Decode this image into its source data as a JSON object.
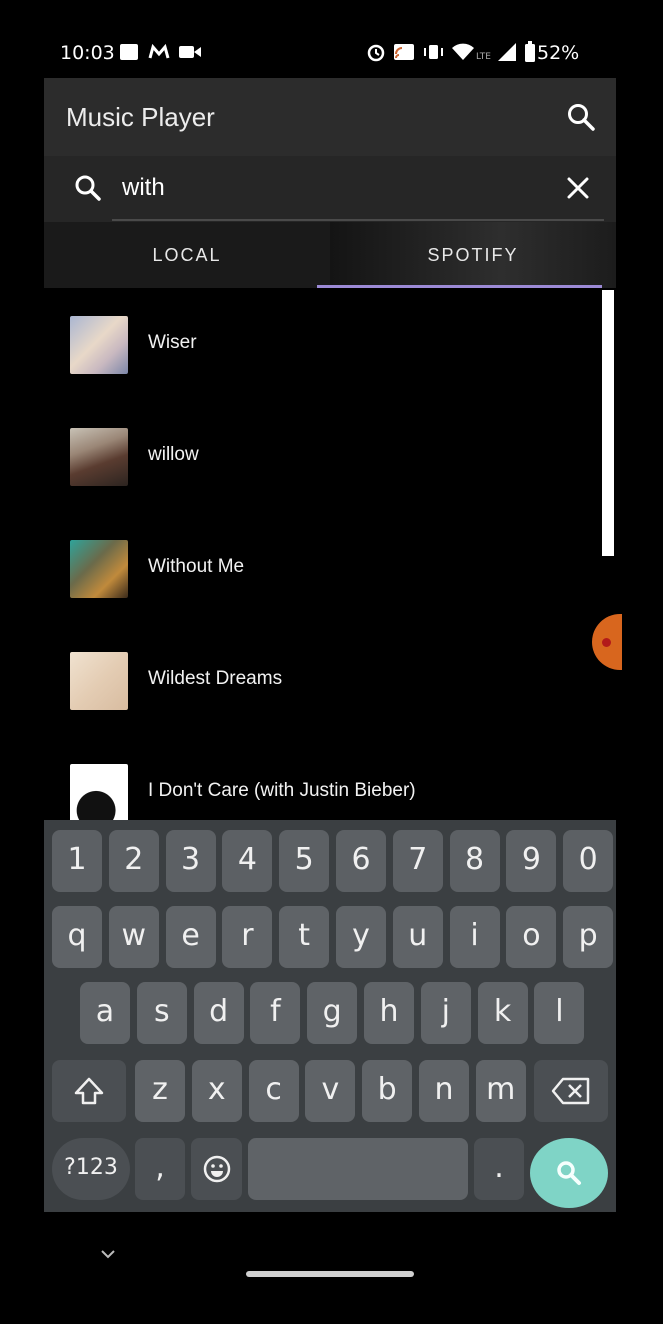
{
  "status_bar": {
    "time": "10:03",
    "battery": "52%",
    "icons": [
      "linkedin-icon",
      "gmail-icon",
      "video-icon",
      "alarm-icon",
      "cast-icon",
      "vibrate-icon",
      "wifi-icon",
      "lte-icon",
      "signal-icon",
      "battery-icon"
    ]
  },
  "app_bar": {
    "title": "Music Player",
    "search_icon": "search-icon"
  },
  "search": {
    "value": "with",
    "search_icon": "search-icon",
    "clear_icon": "close-icon"
  },
  "tabs": [
    {
      "label": "LOCAL",
      "selected": false
    },
    {
      "label": "SPOTIFY",
      "selected": true
    }
  ],
  "colors": {
    "tab_indicator": "#9c8ad6",
    "accent_search_key": "#7fd4c6",
    "fab": "#d8661e"
  },
  "songs": [
    {
      "title": "Wiser"
    },
    {
      "title": "willow"
    },
    {
      "title": "Without Me"
    },
    {
      "title": "Wildest Dreams"
    },
    {
      "title": "I Don't Care (with Justin Bieber)"
    }
  ],
  "keyboard": {
    "row_numbers": [
      "1",
      "2",
      "3",
      "4",
      "5",
      "6",
      "7",
      "8",
      "9",
      "0"
    ],
    "row1": [
      "q",
      "w",
      "e",
      "r",
      "t",
      "y",
      "u",
      "i",
      "o",
      "p"
    ],
    "row2": [
      "a",
      "s",
      "d",
      "f",
      "g",
      "h",
      "j",
      "k",
      "l"
    ],
    "row3": [
      "z",
      "x",
      "c",
      "v",
      "b",
      "n",
      "m"
    ],
    "symbols_key": "?123",
    "comma_key": ",",
    "period_key": ".",
    "shift_icon": "shift-icon",
    "backspace_icon": "backspace-icon",
    "emoji_icon": "emoji-icon",
    "action_icon": "search-icon"
  }
}
